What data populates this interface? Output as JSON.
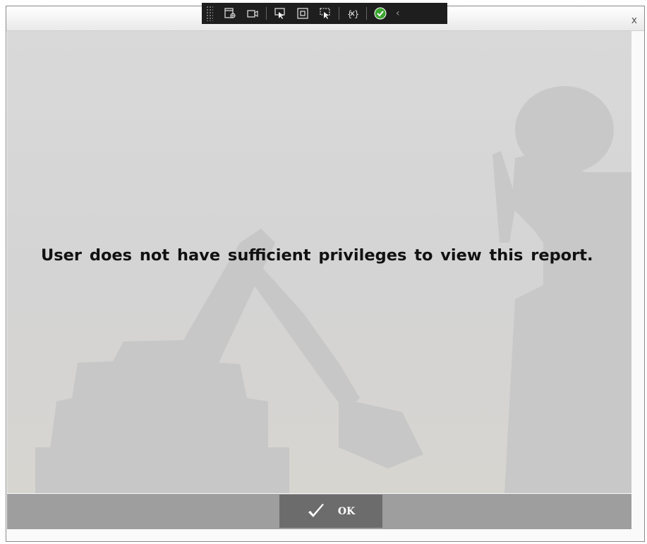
{
  "window": {
    "close_label": "x"
  },
  "devtools_toolbar": {
    "icons": [
      "live-visual-tree-icon",
      "video-icon",
      "select-element-icon",
      "display-adorners-icon",
      "track-focus-icon",
      "binding-icon",
      "hot-reload-ok-icon",
      "collapse-chevron-icon"
    ],
    "collapse_glyph": "‹"
  },
  "dialog": {
    "message": "User does not have sufficient privileges to view this report.",
    "ok_label": "OK"
  },
  "colors": {
    "footer": "#9e9e9e",
    "ok_button": "#6c6c6c",
    "ok_check": "#ffffff",
    "hot_reload_ok": "#3aa52f"
  }
}
